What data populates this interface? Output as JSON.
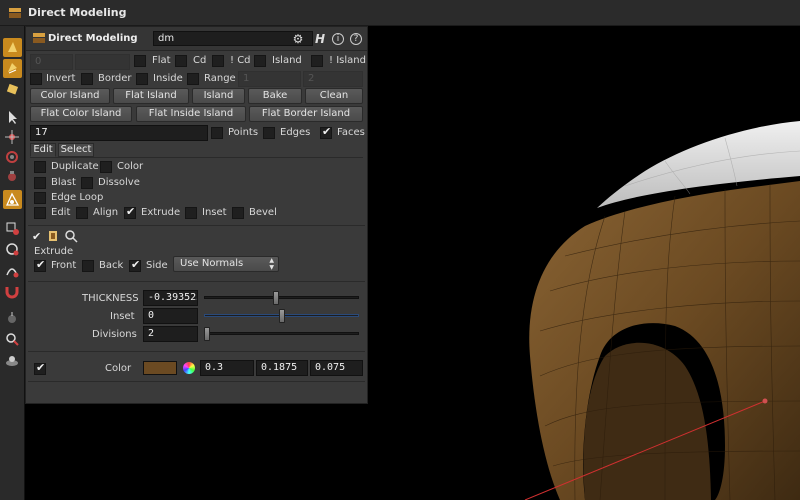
{
  "window": {
    "title": "Direct Modeling"
  },
  "panel": {
    "node_type": "Direct Modeling",
    "node_name": "dm",
    "row1": {
      "field_a": "0",
      "flat": "Flat",
      "cd": "Cd",
      "not_cd": "! Cd",
      "island": "Island",
      "not_island": "! Island"
    },
    "row2": {
      "invert": "Invert",
      "border": "Border",
      "inside": "Inside",
      "range": "Range",
      "range_a": "1",
      "range_b": "2"
    },
    "buttons1": [
      "Color Island",
      "Flat Island",
      "Island",
      "Bake",
      "Clean"
    ],
    "buttons2": [
      "Flat Color Island",
      "Flat Inside Island",
      "Flat Border Island"
    ],
    "selection": {
      "value": "17",
      "points": "Points",
      "edges": "Edges",
      "faces": "Faces"
    },
    "tabs": [
      "Edit",
      "Select"
    ],
    "ops": {
      "duplicate": "Duplicate",
      "color": "Color",
      "blast": "Blast",
      "dissolve": "Dissolve",
      "edge_loop": "Edge Loop",
      "edit": "Edit",
      "align": "Align",
      "extrude": "Extrude",
      "inset": "Inset",
      "bevel": "Bevel"
    },
    "extrude": {
      "section": "Extrude",
      "front": "Front",
      "back": "Back",
      "side": "Side",
      "mode": "Use Normals",
      "thickness_label": "THICKNESS",
      "thickness": "-0.393523",
      "thickness_level": 0.46,
      "inset_label": "Inset",
      "inset": "0",
      "inset_level": 0.5,
      "divisions_label": "Divisions",
      "divisions": "2",
      "divisions_level": 0.0
    },
    "color": {
      "label": "Color",
      "swatch": "#6b4a22",
      "r": "0.3",
      "g": "0.1875",
      "b": "0.075"
    }
  },
  "colors": {
    "accent": "#c98a1e",
    "mesh": "#6b4a22",
    "mesh_top": "#d9d9d9"
  }
}
